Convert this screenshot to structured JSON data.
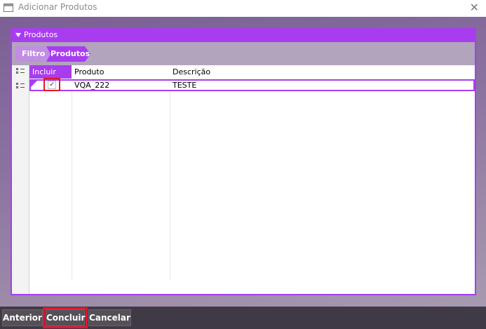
{
  "window": {
    "title": "Adicionar Produtos",
    "close_glyph": "✕"
  },
  "panel": {
    "title": "Produtos"
  },
  "breadcrumb": {
    "items": [
      {
        "label": "Filtro"
      },
      {
        "label": "Produtos"
      }
    ]
  },
  "grid": {
    "columns": [
      "Incluir",
      "Produto",
      "Descrição"
    ],
    "rows": [
      {
        "incluir": "✔",
        "produto": "VQA_222",
        "descricao": "TESTE"
      }
    ]
  },
  "buttons": {
    "anterior": "Anterior",
    "concluir": "Concluir",
    "cancelar": "Cancelar"
  },
  "colors": {
    "accent": "#a83df0",
    "highlight": "#e3162a",
    "bottom_bar": "#3f3a45"
  }
}
